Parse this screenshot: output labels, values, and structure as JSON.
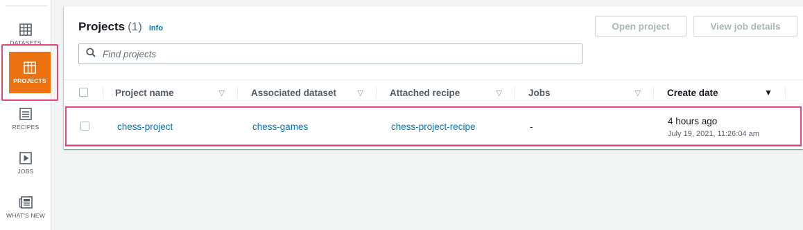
{
  "nav": {
    "items": [
      {
        "label": "DATASETS",
        "icon": "table-icon"
      },
      {
        "label": "PROJECTS",
        "icon": "grid-icon"
      },
      {
        "label": "RECIPES",
        "icon": "list-icon"
      },
      {
        "label": "JOBS",
        "icon": "play-icon"
      },
      {
        "label": "WHAT'S NEW",
        "icon": "newspaper-icon"
      }
    ]
  },
  "header": {
    "title": "Projects",
    "count": "(1)",
    "info": "Info",
    "open_project": "Open project",
    "view_job_details": "View job details"
  },
  "search": {
    "placeholder": "Find projects"
  },
  "table": {
    "columns": [
      "Project name",
      "Associated dataset",
      "Attached recipe",
      "Jobs",
      "Create date"
    ],
    "rows": [
      {
        "project_name": "chess-project",
        "dataset": "chess-games",
        "recipe": "chess-project-recipe",
        "jobs": "-",
        "created_relative": "4 hours ago",
        "created_full": "July 19, 2021, 11:26:04 am"
      }
    ]
  },
  "colors": {
    "accent": "#ec7211",
    "link": "#0073bb",
    "highlight": "#e0457b"
  }
}
